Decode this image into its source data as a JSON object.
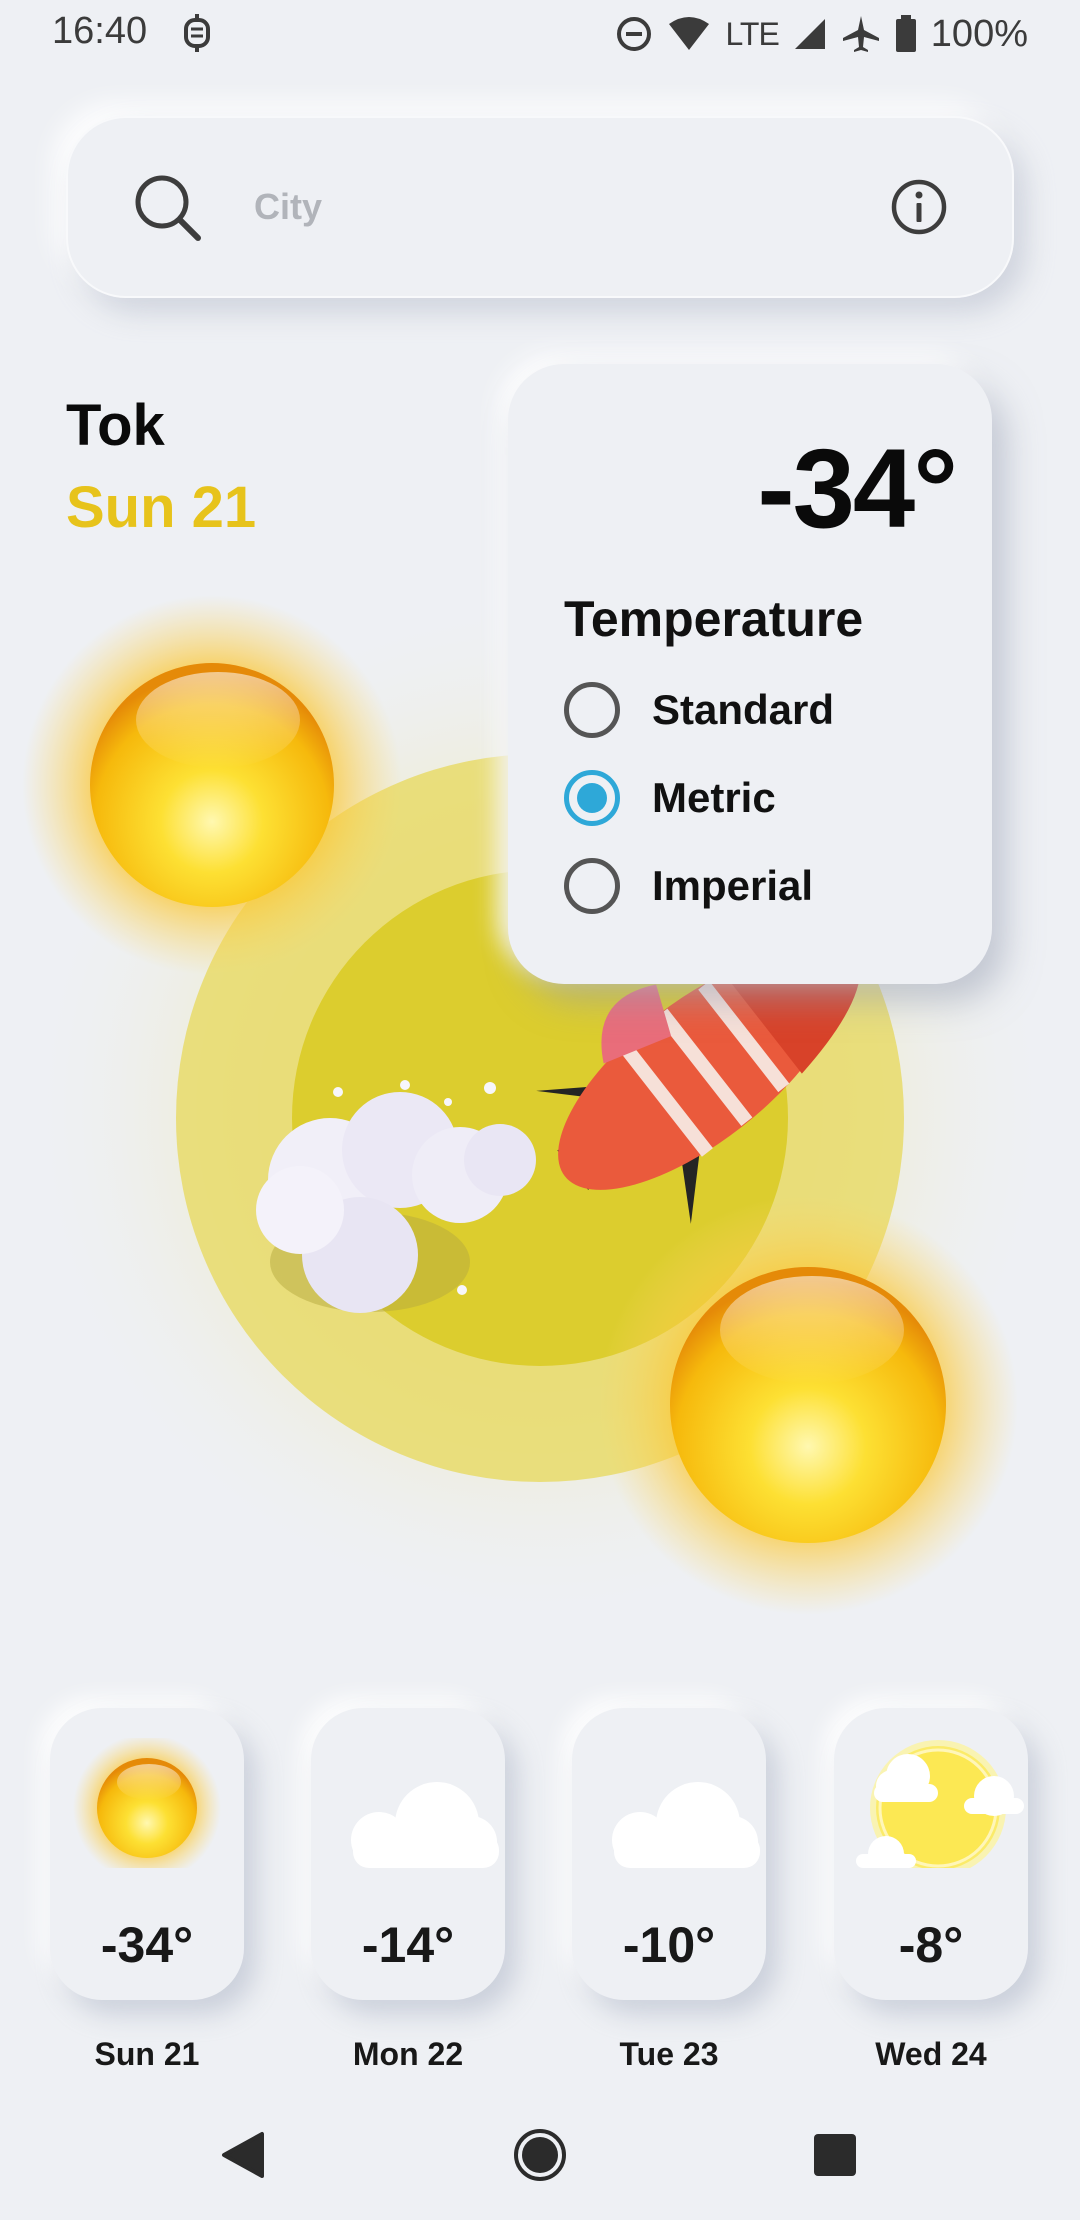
{
  "status_bar": {
    "time": "16:40",
    "network": "LTE",
    "battery": "100%",
    "icons": [
      "notification-icon",
      "do-not-disturb-icon",
      "wifi-icon",
      "cell-signal-icon",
      "airplane-icon",
      "battery-icon"
    ]
  },
  "search": {
    "placeholder": "City",
    "value": "",
    "icon": "search-icon",
    "info_icon": "info-icon"
  },
  "location": {
    "city": "Tok",
    "date": "Sun 21"
  },
  "current": {
    "temperature": "-34°"
  },
  "temperature_panel": {
    "heading": "Temperature",
    "options": [
      {
        "label": "Standard",
        "selected": false
      },
      {
        "label": "Metric",
        "selected": true
      },
      {
        "label": "Imperial",
        "selected": false
      }
    ]
  },
  "forecast": [
    {
      "day": "Sun 21",
      "temp": "-34°",
      "icon": "sun-icon"
    },
    {
      "day": "Mon 22",
      "temp": "-14°",
      "icon": "cloud-icon"
    },
    {
      "day": "Tue 23",
      "temp": "-10°",
      "icon": "cloud-icon"
    },
    {
      "day": "Wed 24",
      "temp": "-8°",
      "icon": "sun-cloud-icon"
    }
  ],
  "colors": {
    "background": "#eef0f4",
    "date_accent": "#e7c31b",
    "radio_selected": "#2ea8d8",
    "sun": "#f7cf10"
  },
  "nav": {
    "back_icon": "back-icon",
    "home_icon": "home-icon",
    "recents_icon": "recents-icon"
  }
}
